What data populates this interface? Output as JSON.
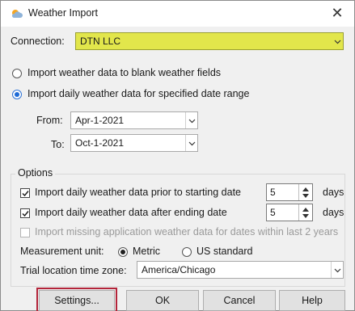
{
  "window": {
    "title": "Weather Import",
    "close_symbol": "✕"
  },
  "connection": {
    "label": "Connection:",
    "value": "DTN LLC"
  },
  "mode": {
    "blank_fields_label": "Import weather data to blank weather fields",
    "date_range_label": "Import daily weather data for specified date range",
    "selected": "date_range"
  },
  "date_range": {
    "from_label": "From:",
    "from_value": "Apr-1-2021",
    "to_label": "To:",
    "to_value": "Oct-1-2021"
  },
  "options": {
    "group_label": "Options",
    "prior": {
      "label": "Import daily weather data prior to starting date",
      "checked": true,
      "days": "5",
      "unit": "days"
    },
    "after": {
      "label": "Import daily weather data after ending date",
      "checked": true,
      "days": "5",
      "unit": "days"
    },
    "missing": {
      "label": "Import missing application weather data for dates within last 2 years",
      "checked": false,
      "enabled": false
    },
    "measurement": {
      "label": "Measurement unit:",
      "metric": "Metric",
      "us": "US standard",
      "selected": "metric"
    },
    "timezone": {
      "label": "Trial location time zone:",
      "value": "America/Chicago"
    }
  },
  "buttons": {
    "settings": "Settings...",
    "ok": "OK",
    "cancel": "Cancel",
    "help": "Help"
  },
  "colors": {
    "accent": "#e2e64b",
    "highlight_outline": "#b3243a"
  }
}
